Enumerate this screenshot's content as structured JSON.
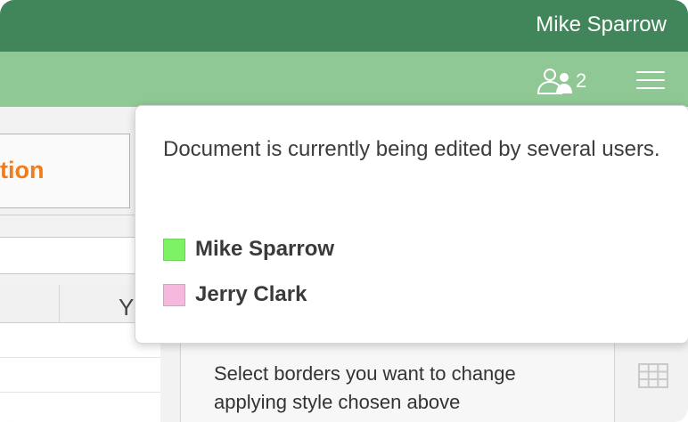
{
  "header": {
    "user_name": "Mike Sparrow",
    "bar_color": "#40865a"
  },
  "toolbar": {
    "color": "#8fc795",
    "users_icon": "users-icon",
    "users_count": "2",
    "menu_icon": "hamburger-menu-icon"
  },
  "document": {
    "caption_text": "tion",
    "caption_color": "#f07c1a",
    "column_letters": [
      "Y"
    ]
  },
  "borders_panel": {
    "description": "Select borders you want to change applying style chosen above",
    "icon": "table-borders-icon"
  },
  "users_popup": {
    "message": "Document is currently being edited by several users.",
    "users": [
      {
        "name": "Mike Sparrow",
        "color": "#7cf264"
      },
      {
        "name": "Jerry Clark",
        "color": "#f6b8dc"
      }
    ]
  }
}
